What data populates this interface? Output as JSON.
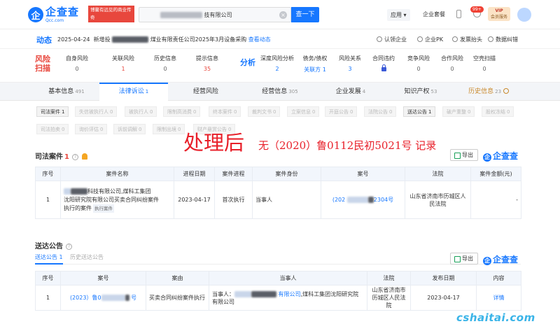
{
  "header": {
    "logo_mark": "企",
    "logo_text": "企查查",
    "logo_sub": "Qcc.com",
    "slogan_line1": "博鳌有远见的商业传奇",
    "slogan_line2": "全国企业信用查询系统",
    "search_value": "技有限公司",
    "search_button": "查一下",
    "apps": "应用",
    "suite": "企业套餐",
    "badge": "99+",
    "vip_top": "VIP",
    "vip_bottom": "会员服务"
  },
  "dynamics": {
    "title": "动态",
    "date": "2025-04-24",
    "text_a": "新增投",
    "text_b": "煤业有限责任公司2025年3月设备采购",
    "view_link": "查看动态",
    "actions": [
      "认领企业",
      "企业PK",
      "发票抬头",
      "数据纠错"
    ]
  },
  "risk": {
    "label": "风险扫描",
    "items": [
      {
        "name": "自身风险",
        "value": "0"
      },
      {
        "name": "关联风险",
        "value": "1"
      },
      {
        "name": "历史信息",
        "value": "0"
      },
      {
        "name": "提示信息",
        "value": "35"
      }
    ]
  },
  "analysis": {
    "label": "分析",
    "items": [
      {
        "name": "深度风险分析",
        "value": "2"
      },
      {
        "name": "债务/债权",
        "value": "关联方 1"
      },
      {
        "name": "风险关系",
        "value": "3"
      },
      {
        "name": "合同违约",
        "value": ""
      },
      {
        "name": "竞争风险",
        "value": "0"
      },
      {
        "name": "合作风险",
        "value": "0"
      },
      {
        "name": "空壳扫描",
        "value": "0"
      }
    ]
  },
  "tabs": [
    {
      "label": "基本信息",
      "count": "491"
    },
    {
      "label": "法律诉讼",
      "count": "1"
    },
    {
      "label": "经营风险",
      "count": ""
    },
    {
      "label": "经营信息",
      "count": "305"
    },
    {
      "label": "企业发展",
      "count": "4"
    },
    {
      "label": "知识产权",
      "count": "53"
    },
    {
      "label": "历史信息",
      "count": "23"
    }
  ],
  "filters_row1": [
    {
      "label": "司法案件",
      "count": "1"
    },
    {
      "label": "失信被执行人",
      "count": "0"
    },
    {
      "label": "被执行人",
      "count": "0"
    },
    {
      "label": "限制高消费",
      "count": "0"
    },
    {
      "label": "终本案件",
      "count": "0"
    },
    {
      "label": "裁判文书",
      "count": "0"
    },
    {
      "label": "立案信息",
      "count": "0"
    },
    {
      "label": "开庭公告",
      "count": "0"
    },
    {
      "label": "法院公告",
      "count": "0"
    },
    {
      "label": "送达公告",
      "count": "1"
    },
    {
      "label": "破产重整",
      "count": "0"
    },
    {
      "label": "股权冻结",
      "count": "0"
    }
  ],
  "filters_row2": [
    {
      "label": "司法拍卖",
      "count": "0"
    },
    {
      "label": "询价评估",
      "count": "0"
    },
    {
      "label": "诉前调解",
      "count": "0"
    },
    {
      "label": "限制出境",
      "count": "0"
    },
    {
      "label": "财产悬赏公告",
      "count": "0"
    }
  ],
  "overlay": {
    "after_label": "处理后",
    "record_text": "无（2020）鲁0112民初5021号 记录"
  },
  "case_section": {
    "title": "司法案件",
    "count": "1",
    "export": "导出",
    "brand": "企查查",
    "columns": [
      "序号",
      "案件名称",
      "进程日期",
      "案件进程",
      "案件身份",
      "案号",
      "法院",
      "案件金额(元)"
    ],
    "row": {
      "index": "1",
      "name_a": "科技有限公司,煤科工集团",
      "name_b": "沈阳研究院有限公司买卖合同纠纷案件",
      "name_c": "执行的案件",
      "tag": "执行案件",
      "date": "2023-04-17",
      "progress": "首次执行",
      "role": "当事人",
      "case_no_a": "(202",
      "case_no_b": "2304号",
      "court": "山东省济南市历城区人民法院",
      "amount": "-"
    }
  },
  "service_section": {
    "title": "送达公告",
    "count": "1",
    "subtab_current": "送达公告 1",
    "subtab_history": "历史送达公告",
    "export": "导出",
    "brand": "企查查",
    "columns": [
      "序号",
      "案号",
      "案由",
      "当事人",
      "法院",
      "发布日期",
      "内容"
    ],
    "row": {
      "index": "1",
      "case_no_a": "(2023）鲁0",
      "case_no_b": "号",
      "cause": "买卖合同纠纷案件执行",
      "party_prefix": "当事人：",
      "party_link": "有限公司",
      "party_rest": ",煤科工集团沈阳研究院有限公司",
      "court": "山东省济南市历城区人民法院",
      "date": "2023-04-17",
      "detail": "详情"
    }
  },
  "site_watermark": "cshaitai.com"
}
